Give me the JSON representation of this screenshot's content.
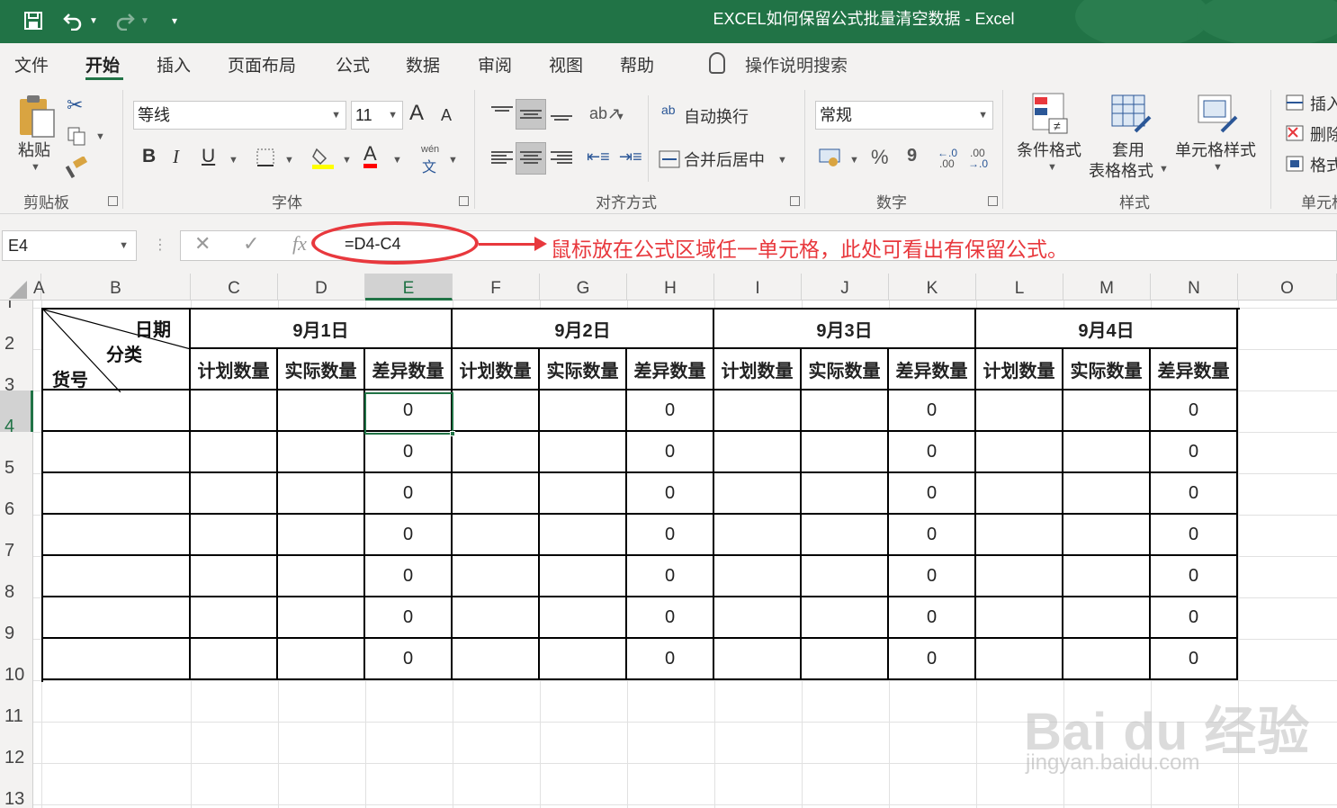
{
  "window": {
    "title": "EXCEL如何保留公式批量清空数据  -  Excel"
  },
  "ribbon_tabs": [
    "文件",
    "开始",
    "插入",
    "页面布局",
    "公式",
    "数据",
    "审阅",
    "视图",
    "帮助"
  ],
  "tell_me": "操作说明搜索",
  "clipboard": {
    "paste": "粘贴",
    "group": "剪贴板"
  },
  "font": {
    "name": "等线",
    "size": "11",
    "bold": "B",
    "italic": "I",
    "underline": "U",
    "grow": "A",
    "shrink": "A",
    "font_color": "A",
    "phonetic_top": "wén",
    "phonetic_bottom": "文",
    "group": "字体"
  },
  "alignment": {
    "wrap": "自动换行",
    "merge": "合并后居中",
    "wrap_icon": "ab",
    "group": "对齐方式"
  },
  "number": {
    "format": "常规",
    "percent": "%",
    "comma": "9",
    "inc_decimal_top": "←.0",
    "inc_decimal_bottom": ".00",
    "dec_decimal_top": ".00",
    "dec_decimal_bottom": "→.0",
    "group": "数字"
  },
  "styles": {
    "conditional": "条件格式",
    "table_top": "套用",
    "table_bottom": "表格格式",
    "cell_styles": "单元格样式",
    "group": "样式"
  },
  "cells": {
    "insert": "插入",
    "delete": "删除",
    "format": "格式",
    "group": "单元格"
  },
  "formula_bar": {
    "name_box": "E4",
    "formula": "=D4-C4",
    "fx": "fx",
    "cancel": "✕",
    "enter": "✓"
  },
  "annotation": "鼠标放在公式区域任一单元格，此处可看出有保留公式。",
  "columns": [
    "A",
    "B",
    "C",
    "D",
    "E",
    "F",
    "G",
    "H",
    "I",
    "J",
    "K",
    "L",
    "M",
    "N",
    "O"
  ],
  "rows": [
    "1",
    "2",
    "3",
    "4",
    "5",
    "6",
    "7",
    "8",
    "9",
    "10",
    "11",
    "12",
    "13"
  ],
  "table": {
    "corner_date": "日期",
    "corner_category": "分类",
    "corner_item": "货号",
    "dates": [
      "9月1日",
      "9月2日",
      "9月3日",
      "9月4日"
    ],
    "sub_headers": [
      "计划数量",
      "实际数量",
      "差异数量",
      "计划数量",
      "实际数量",
      "差异数量",
      "计划数量",
      "实际数量",
      "差异数量",
      "计划数量",
      "实际数量",
      "差异数量"
    ],
    "diff_values": [
      [
        "0",
        "0",
        "0",
        "0"
      ],
      [
        "0",
        "0",
        "0",
        "0"
      ],
      [
        "0",
        "0",
        "0",
        "0"
      ],
      [
        "0",
        "0",
        "0",
        "0"
      ],
      [
        "0",
        "0",
        "0",
        "0"
      ],
      [
        "0",
        "0",
        "0",
        "0"
      ],
      [
        "0",
        "0",
        "0",
        "0"
      ]
    ]
  },
  "watermark": {
    "main": "Bai du 经验",
    "url": "jingyan.baidu.com"
  },
  "colors": {
    "excel_green": "#217346",
    "annotation_red": "#e8383d"
  }
}
